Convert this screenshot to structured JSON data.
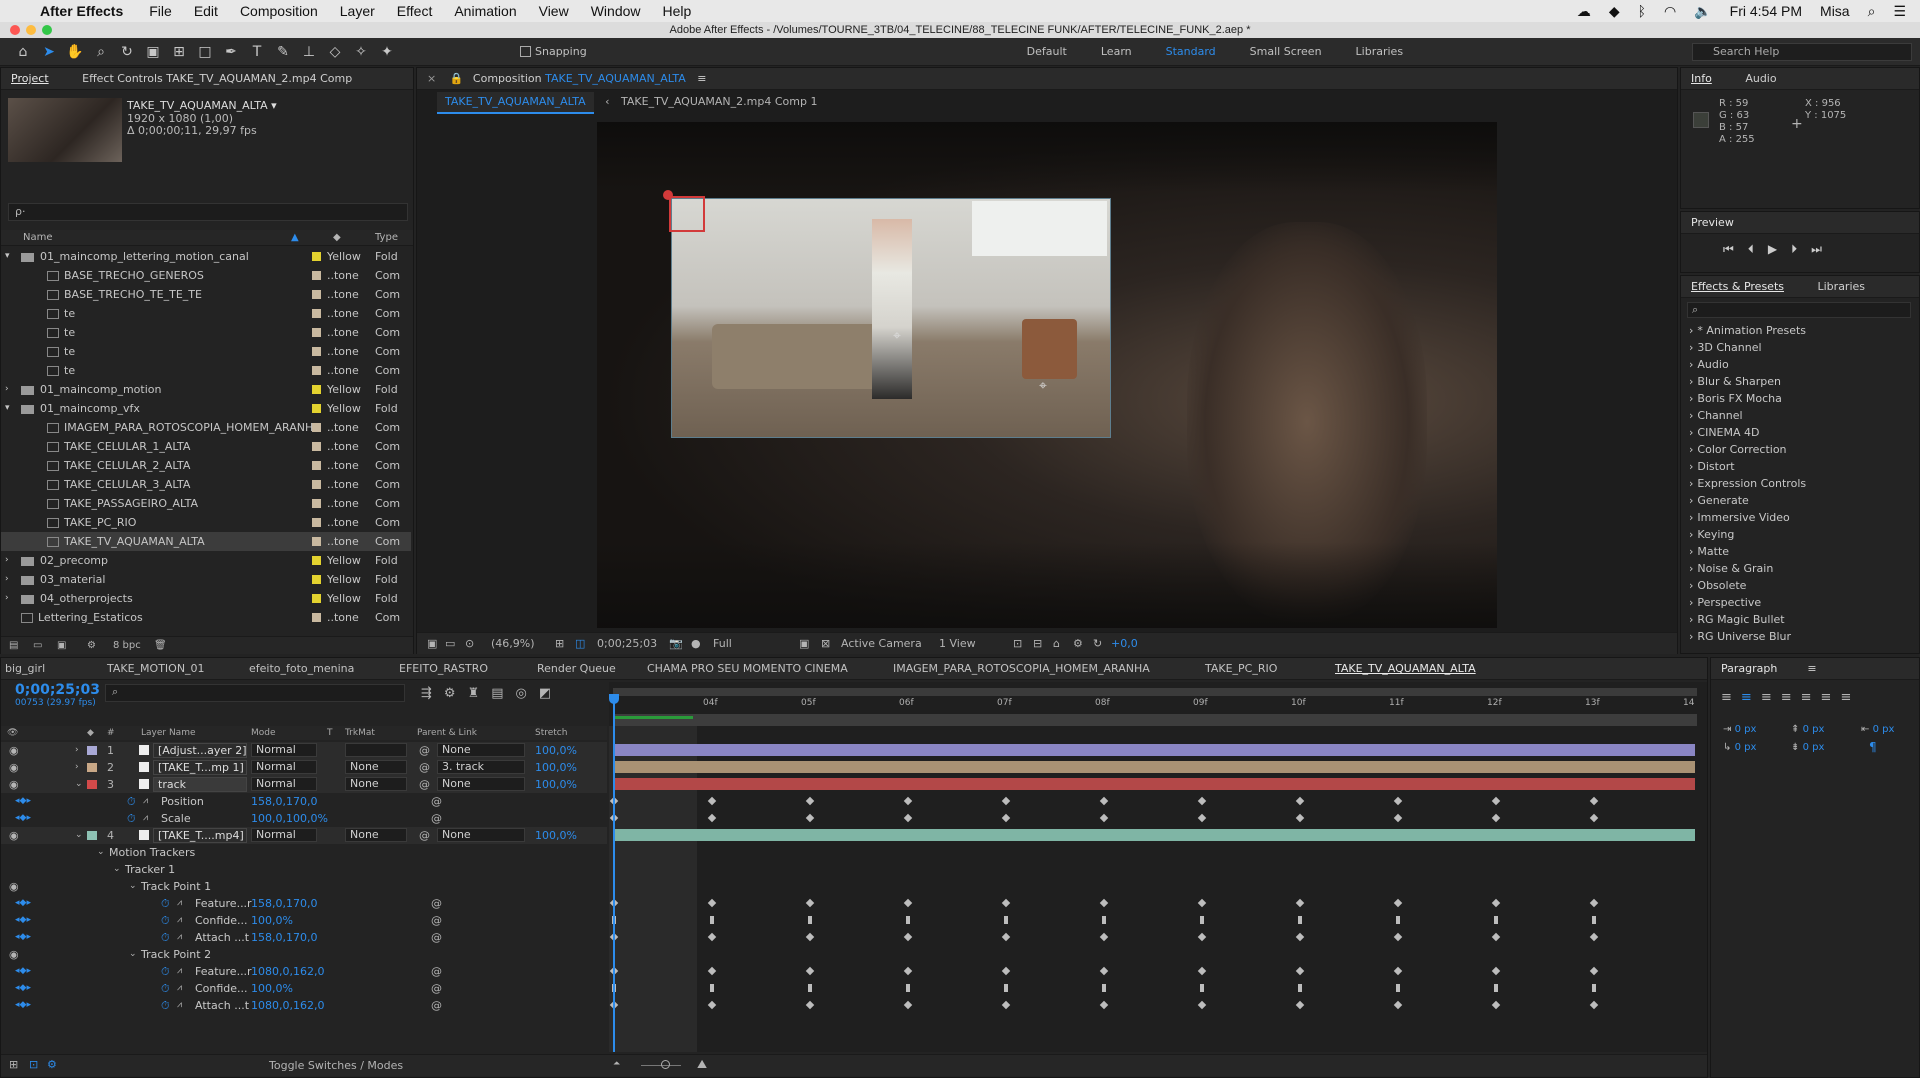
{
  "menubar": {
    "app": "After Effects",
    "items": [
      "File",
      "Edit",
      "Composition",
      "Layer",
      "Effect",
      "Animation",
      "View",
      "Window",
      "Help"
    ],
    "clock": "Fri 4:54 PM",
    "user": "Misa"
  },
  "window_title": "Adobe After Effects - /Volumes/TOURNE_3TB/04_TELECINE/88_TELECINE FUNK/AFTER/TELECINE_FUNK_2.aep *",
  "toolbar": {
    "snapping": "Snapping",
    "workspaces": [
      "Default",
      "Learn",
      "Standard",
      "Small Screen",
      "Libraries"
    ],
    "active_workspace": "Standard",
    "search_placeholder": "Search Help"
  },
  "project_panel": {
    "tab": "Project",
    "tab2": "Effect Controls TAKE_TV_AQUAMAN_2.mp4 Comp",
    "item_name": "TAKE_TV_AQUAMAN_ALTA ▾",
    "item_size": "1920 x 1080 (1,00)",
    "item_duration": "Δ 0;00;00;11, 29,97 fps",
    "search_placeholder": "ρ·",
    "columns": [
      "Name",
      "Type"
    ],
    "bpc": "8 bpc",
    "items": [
      {
        "name": "01_maincomp_lettering_motion_canal",
        "label": "Yellow",
        "type": "Fold",
        "level": 0,
        "folder": true,
        "open": true
      },
      {
        "name": "BASE_TRECHO_GENEROS",
        "label": "..tone",
        "type": "Com",
        "level": 1
      },
      {
        "name": "BASE_TRECHO_TE_TE_TE",
        "label": "..tone",
        "type": "Com",
        "level": 1
      },
      {
        "name": "te",
        "label": "..tone",
        "type": "Com",
        "level": 1
      },
      {
        "name": "te",
        "label": "..tone",
        "type": "Com",
        "level": 1
      },
      {
        "name": "te",
        "label": "..tone",
        "type": "Com",
        "level": 1
      },
      {
        "name": "te",
        "label": "..tone",
        "type": "Com",
        "level": 1
      },
      {
        "name": "01_maincomp_motion",
        "label": "Yellow",
        "type": "Fold",
        "level": 0,
        "folder": true
      },
      {
        "name": "01_maincomp_vfx",
        "label": "Yellow",
        "type": "Fold",
        "level": 0,
        "folder": true,
        "open": true
      },
      {
        "name": "IMAGEM_PARA_ROTOSCOPIA_HOMEM_ARANHA",
        "label": "..tone",
        "type": "Com",
        "level": 1
      },
      {
        "name": "TAKE_CELULAR_1_ALTA",
        "label": "..tone",
        "type": "Com",
        "level": 1
      },
      {
        "name": "TAKE_CELULAR_2_ALTA",
        "label": "..tone",
        "type": "Com",
        "level": 1
      },
      {
        "name": "TAKE_CELULAR_3_ALTA",
        "label": "..tone",
        "type": "Com",
        "level": 1
      },
      {
        "name": "TAKE_PASSAGEIRO_ALTA",
        "label": "..tone",
        "type": "Com",
        "level": 1
      },
      {
        "name": "TAKE_PC_RIO",
        "label": "..tone",
        "type": "Com",
        "level": 1
      },
      {
        "name": "TAKE_TV_AQUAMAN_ALTA",
        "label": "..tone",
        "type": "Com",
        "level": 1,
        "selected": true
      },
      {
        "name": "02_precomp",
        "label": "Yellow",
        "type": "Fold",
        "level": 0,
        "folder": true
      },
      {
        "name": "03_material",
        "label": "Yellow",
        "type": "Fold",
        "level": 0,
        "folder": true
      },
      {
        "name": "04_otherprojects",
        "label": "Yellow",
        "type": "Fold",
        "level": 0,
        "folder": true
      },
      {
        "name": "Lettering_Estaticos",
        "label": "..tone",
        "type": "Com",
        "level": 0
      }
    ]
  },
  "comp_panel": {
    "tab_prefix": "Composition",
    "tab_name": "TAKE_TV_AQUAMAN_ALTA",
    "flow": [
      "TAKE_TV_AQUAMAN_ALTA",
      "TAKE_TV_AQUAMAN_2.mp4 Comp 1"
    ],
    "zoom": "(46,9%)",
    "timecode": "0;00;25;03",
    "resolution": "Full",
    "camera": "Active Camera",
    "views": "1 View",
    "exposure": "+0,0"
  },
  "info_panel": {
    "tabs": [
      "Info",
      "Audio"
    ],
    "r": "R : 59",
    "g": "G : 63",
    "b": "B : 57",
    "a": "A : 255",
    "x": "X : 956",
    "y": "Y : 1075",
    "swatch": "#3b3f39"
  },
  "preview_panel": {
    "title": "Preview"
  },
  "effects_panel": {
    "tabs": [
      "Effects & Presets",
      "Libraries"
    ],
    "items": [
      "* Animation Presets",
      "3D Channel",
      "Audio",
      "Blur & Sharpen",
      "Boris FX Mocha",
      "Channel",
      "CINEMA 4D",
      "Color Correction",
      "Distort",
      "Expression Controls",
      "Generate",
      "Immersive Video",
      "Keying",
      "Matte",
      "Noise & Grain",
      "Obsolete",
      "Perspective",
      "RG Magic Bullet",
      "RG Universe Blur"
    ]
  },
  "paragraph_panel": {
    "title": "Paragraph",
    "vals": [
      "0 px",
      "0 px",
      "0 px",
      "0 px",
      "0 px"
    ]
  },
  "timeline": {
    "tabs": [
      "big_girl",
      "TAKE_MOTION_01",
      "efeito_foto_menina",
      "EFEITO_RASTRO",
      "Render Queue",
      "CHAMA PRO SEU MOMENTO CINEMA",
      "IMAGEM_PARA_ROTOSCOPIA_HOMEM_ARANHA",
      "TAKE_PC_RIO",
      "TAKE_TV_AQUAMAN_ALTA"
    ],
    "active_tab": "TAKE_TV_AQUAMAN_ALTA",
    "timecode": "0;00;25;03",
    "frames": "00753 (29.97 fps)",
    "columns": [
      "Layer Name",
      "Mode",
      "T",
      "TrkMat",
      "Parent & Link",
      "Stretch"
    ],
    "ruler": [
      "04f",
      "05f",
      "06f",
      "07f",
      "08f",
      "09f",
      "10f",
      "11f",
      "12f",
      "13f",
      "14"
    ],
    "footer": "Toggle Switches / Modes",
    "layers": [
      {
        "num": "1",
        "name": "[Adjust...ayer 2]",
        "mode": "Normal",
        "trk": "",
        "parent": "None",
        "stretch": "100,0%",
        "color": "#a9a9d6",
        "bar": "#8a86c4"
      },
      {
        "num": "2",
        "name": "[TAKE_T...mp 1]",
        "mode": "Normal",
        "trk": "None",
        "parent": "3. track",
        "stretch": "100,0%",
        "color": "#c9a887",
        "bar": "#a99274"
      },
      {
        "num": "3",
        "name": "track",
        "mode": "Normal",
        "trk": "None",
        "parent": "None",
        "stretch": "100,0%",
        "color": "#d24a4a",
        "bar": "#b34848"
      },
      {
        "num": "4",
        "name": "[TAKE_T....mp4]",
        "mode": "Normal",
        "trk": "None",
        "parent": "None",
        "stretch": "100,0%",
        "color": "#8ec2b4",
        "bar": "#7fb5a5"
      }
    ],
    "props": {
      "position_label": "Position",
      "position": "158,0,170,0",
      "scale_label": "Scale",
      "scale": "100,0,100,0%",
      "motion_trackers": "Motion Trackers",
      "tracker1": "Tracker 1",
      "tp1": "Track Point 1",
      "tp2": "Track Point 2",
      "feature": "Feature...r",
      "confidence": "Confide...",
      "attach": "Attach ...t",
      "tp1_feature": "158,0,170,0",
      "tp1_conf": "100,0%",
      "tp1_attach": "158,0,170,0",
      "tp2_feature": "1080,0,162,0",
      "tp2_conf": "100,0%",
      "tp2_attach": "1080,0,162,0"
    }
  }
}
